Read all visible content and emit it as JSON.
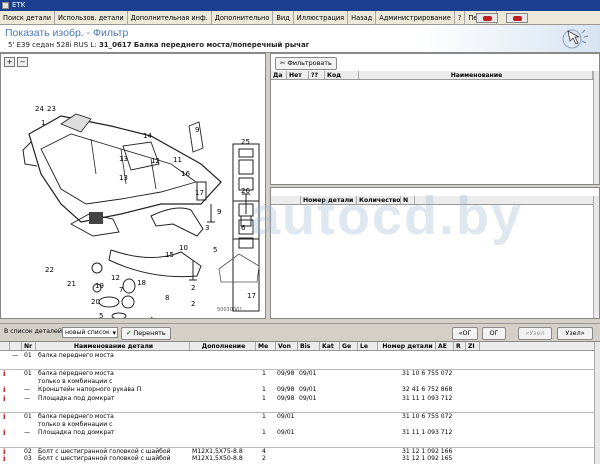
{
  "window": {
    "title": "ETK"
  },
  "menu": {
    "items": [
      "Поиск детали",
      "Использов. детали",
      "Дополнительная инф.",
      "Дополнительно",
      "Вид",
      "Иллюстрация",
      "Назад",
      "Администрирование",
      "?",
      "Печать"
    ]
  },
  "header": {
    "title": "Показать изобр. - Фильтр",
    "model": "5' E39 седан 528i RUS L",
    "group_code": "31_0617",
    "group_name": "Балка переднего моста/поперечный рычаг"
  },
  "illustration": {
    "zoom_in": "+",
    "zoom_out": "−",
    "callouts": [
      "24",
      "23",
      "1",
      "14",
      "9",
      "13",
      "12",
      "11",
      "16",
      "17",
      "13",
      "25",
      "26",
      "6",
      "9",
      "3",
      "5",
      "15",
      "10",
      "22",
      "21",
      "19",
      "20",
      "7",
      "18",
      "8",
      "2",
      "17",
      "4",
      "5",
      "6",
      "2",
      "12"
    ],
    "image_code": "50030001"
  },
  "filter_pane": {
    "filter_button": "Фильтровать",
    "columns": [
      "Да",
      "Нет",
      "??",
      "Код",
      "Наименование"
    ]
  },
  "parts_pane": {
    "columns": [
      "",
      "Номер детали",
      "Количество",
      "N"
    ]
  },
  "watermark": "autocd.by",
  "toolbar": {
    "list_label": "В список деталей",
    "list_select": "новый список",
    "transfer_button": "Перенять",
    "btn_first": "«ОГ",
    "btn_og": "ОГ",
    "btn_node_prev": "«Узел",
    "btn_node_next": "Узел»"
  },
  "table": {
    "columns": [
      "",
      "",
      "Nr",
      "Наименование детали",
      "Дополнение",
      "Me",
      "Von",
      "Bis",
      "Kat",
      "Ge",
      "Le",
      "Номер детали",
      "AE",
      "R",
      "ZI"
    ],
    "rows": [
      {
        "info": "",
        "dash": "—",
        "nr": "01",
        "name": "балка переднего моста",
        "extra": "",
        "me": "",
        "von": "",
        "bis": "",
        "part": ""
      },
      {
        "info": "",
        "dash": "",
        "nr": "",
        "name": "",
        "extra": "",
        "me": "",
        "von": "",
        "bis": "",
        "part": ""
      },
      {
        "info": "i",
        "dash": "",
        "nr": "01",
        "name": "балка переднего моста",
        "extra": "",
        "me": "1",
        "von": "09/98",
        "bis": "09/01",
        "part": "31 10 6 755 072"
      },
      {
        "info": "",
        "dash": "",
        "nr": "",
        "name": "только в комбинации с",
        "extra": "",
        "me": "",
        "von": "",
        "bis": "",
        "part": ""
      },
      {
        "info": "i",
        "dash": "—",
        "nr": "",
        "name": "Кронштейн напорного рукава П",
        "extra": "",
        "me": "1",
        "von": "09/98",
        "bis": "09/01",
        "part": "32 41 6 752 868"
      },
      {
        "info": "i",
        "dash": "—",
        "nr": "",
        "name": "Площадка под домкрат",
        "extra": "",
        "me": "1",
        "von": "09/98",
        "bis": "09/01",
        "part": "31 11 1 093 712"
      },
      {
        "info": "",
        "dash": "",
        "nr": "",
        "name": "",
        "extra": "",
        "me": "",
        "von": "",
        "bis": "",
        "part": ""
      },
      {
        "info": "i",
        "dash": "",
        "nr": "01",
        "name": "балка переднего моста",
        "extra": "",
        "me": "1",
        "von": "09/01",
        "bis": "",
        "part": "31 10 6 755 072"
      },
      {
        "info": "",
        "dash": "",
        "nr": "",
        "name": "только в комбинации с",
        "extra": "",
        "me": "",
        "von": "",
        "bis": "",
        "part": ""
      },
      {
        "info": "i",
        "dash": "—",
        "nr": "",
        "name": "Площадка под домкрат",
        "extra": "",
        "me": "1",
        "von": "09/01",
        "bis": "",
        "part": "31 11 1 093 712"
      },
      {
        "info": "",
        "dash": "",
        "nr": "",
        "name": "",
        "extra": "",
        "me": "",
        "von": "",
        "bis": "",
        "part": ""
      },
      {
        "info": "i",
        "dash": "",
        "nr": "02",
        "name": "Болт с шестигранной головкой с шайбой",
        "extra": "M12X1,5X75-8.8",
        "me": "4",
        "von": "",
        "bis": "",
        "part": "31 12 1 092 166"
      },
      {
        "info": "i",
        "dash": "",
        "nr": "03",
        "name": "Болт с шестигранной головкой с шайбой",
        "extra": "M12X1,5X50-8.8",
        "me": "2",
        "von": "",
        "bis": "",
        "part": "31 12 1 092 165"
      }
    ]
  }
}
